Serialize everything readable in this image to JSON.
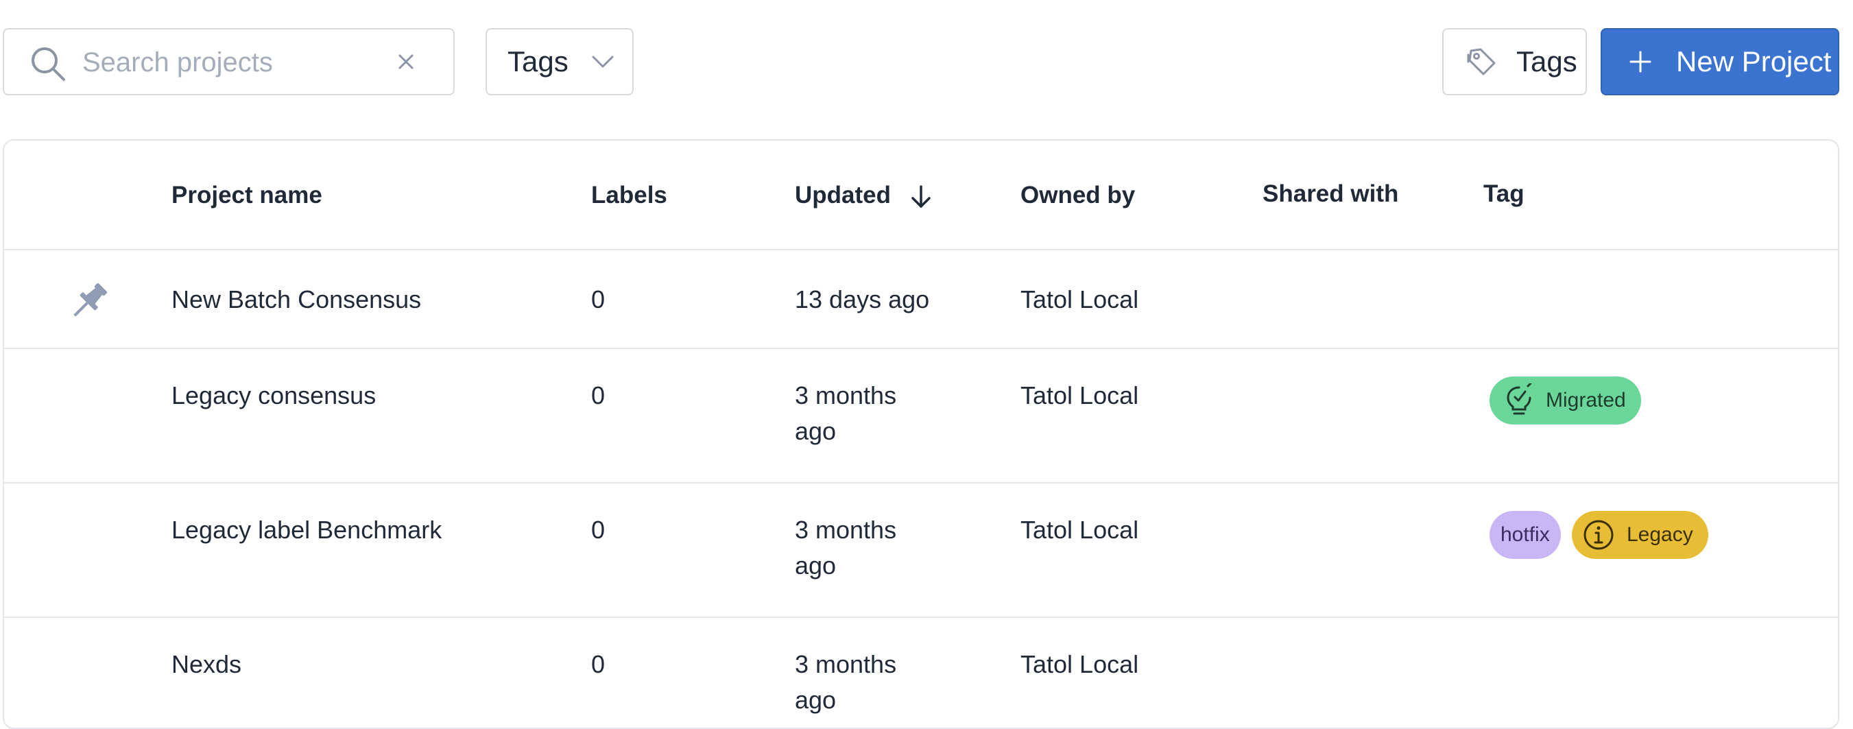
{
  "toolbar": {
    "search_placeholder": "Search projects",
    "search_value": "",
    "tags_filter_label": "Tags",
    "tags_button_label": "Tags",
    "new_project_label": "New Project"
  },
  "table": {
    "columns": {
      "project_name": "Project name",
      "labels": "Labels",
      "updated": "Updated",
      "owned_by": "Owned by",
      "shared_with": "Shared with",
      "tag": "Tag"
    },
    "rows": [
      {
        "name": "New Batch Consensus",
        "labels": "0",
        "updated_line1": "13 days ago",
        "updated_line2": "",
        "owner": "Tatol Local",
        "shared": "",
        "pinned": true,
        "tags": []
      },
      {
        "name": "Legacy consensus",
        "labels": "0",
        "updated_line1": "3 months",
        "updated_line2": "ago",
        "owner": "Tatol Local",
        "shared": "",
        "pinned": false,
        "tags": [
          "Migrated"
        ]
      },
      {
        "name": "Legacy label Benchmark",
        "labels": "0",
        "updated_line1": "3 months",
        "updated_line2": "ago",
        "owner": "Tatol Local",
        "shared": "",
        "pinned": false,
        "tags": [
          "hotfix",
          "Legacy"
        ]
      },
      {
        "name": "Nexds",
        "labels": "0",
        "updated_line1": "3 months",
        "updated_line2": "ago",
        "owner": "Tatol Local",
        "shared": "",
        "pinned": false,
        "tags": []
      }
    ]
  },
  "tags": {
    "migrated": {
      "label": "Migrated",
      "color": "#6ad69a",
      "icon": "lightbulb-check-icon"
    },
    "hotfix": {
      "label": "hotfix",
      "color": "#cbb6f5"
    },
    "legacy": {
      "label": "Legacy",
      "color": "#e6bd34",
      "icon": "info-icon"
    }
  },
  "colors": {
    "primary": "#3b73d1",
    "border": "#d7dbe0",
    "text": "#1f2937",
    "placeholder": "#a4adb9"
  },
  "icons": {
    "search": "search-icon",
    "clear": "close-icon",
    "chevron": "chevron-down-icon",
    "tag": "tag-icon",
    "plus": "plus-icon",
    "sort": "arrow-down-icon",
    "pin": "pin-icon"
  }
}
